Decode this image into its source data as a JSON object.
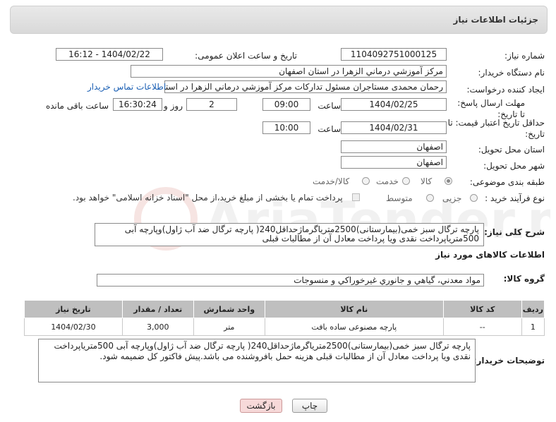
{
  "header": {
    "title": "جزئیات اطلاعات نیاز"
  },
  "fields": {
    "need_number_label": "شماره نیاز:",
    "need_number": "1104092751000125",
    "announce_label": "تاریخ و ساعت اعلان عمومی:",
    "announce_value": "1404/02/22 - 16:12",
    "buyer_org_label": "نام دستگاه خریدار:",
    "buyer_org": "مرکز آموزشي درماني الزهرا در استان اصفهان",
    "creator_label": "ایجاد کننده درخواست:",
    "creator": "رحمان محمدی مستاجران مسئول تدارکات مرکز آموزشي درماني الزهرا در استان اصفهان",
    "contact_link": "اطلاعات تماس خریدار",
    "deadline_label": "مهلت ارسال پاسخ: تا تاریخ:",
    "deadline_date": "1404/02/25",
    "time_label": "ساعت",
    "deadline_time": "09:00",
    "days_value": "2",
    "days_label": "روز و",
    "remaining_time": "16:30:24",
    "remaining_label": "ساعت باقی مانده",
    "price_validity_label": "حداقل تاریخ اعتبار قیمت: تا تاریخ:",
    "price_validity_date": "1404/02/31",
    "price_validity_time": "10:00",
    "province_label": "استان محل تحویل:",
    "province": "اصفهان",
    "city_label": "شهر محل تحویل:",
    "city": "اصفهان",
    "category_label": "طبقه بندی موضوعی:",
    "category_opt1": "کالا",
    "category_opt2": "خدمت",
    "category_opt3": "کالا/خدمت",
    "process_label": "نوع فرآیند خرید :",
    "process_opt1": "جزیی",
    "process_opt2": "متوسط",
    "process_note": "پرداخت تمام یا بخشی از مبلغ خرید،از محل \"اسناد خزانه اسلامی\" خواهد بود."
  },
  "description": {
    "label": "شرح کلی نیاز:",
    "text": "پارچه ترگال سبز خمی(بیمارستانی)2500متریاگرماژحداقل240( پارچه ترگال ضد آب ژاول)وپارچه آبی 500متریاپرداخت نقدی ویا پرداخت معادل آن از مطالبات قبلی"
  },
  "goods_info": {
    "title": "اطلاعات کالاهای مورد نیاز",
    "group_label": "گروه کالا:",
    "group_value": "مواد معدني، گياهي و جانوري غيرخوراکي و منسوجات"
  },
  "table": {
    "headers": [
      "ردیف",
      "کد کالا",
      "نام کالا",
      "واحد شمارش",
      "تعداد / مقدار",
      "تاریخ نیاز"
    ],
    "rows": [
      [
        "1",
        "--",
        "پارچه مصنوعی ساده بافت",
        "متر",
        "3,000",
        "1404/02/30"
      ]
    ]
  },
  "buyer_notes": {
    "label": "توضیحات خریدار:",
    "text": "پارچه ترگال سبز خمی(بیمارستانی)2500متریاگرماژحداقل240( پارچه ترگال ضد آب ژاول)وپارچه آبی 500متریاپرداخت نقدی ویا پرداخت معادل آن از مطالبات قبلی هزینه حمل بافروشنده می باشد.پیش فاکتور کل ضمیمه شود."
  },
  "buttons": {
    "print": "چاپ",
    "back": "بازگشت"
  },
  "watermark": {
    "text": "AriaTender.neT"
  },
  "colors": {
    "link": "#1a5fb4",
    "back_button": "#f7d9d9",
    "table_header": "#bfbfbf"
  }
}
